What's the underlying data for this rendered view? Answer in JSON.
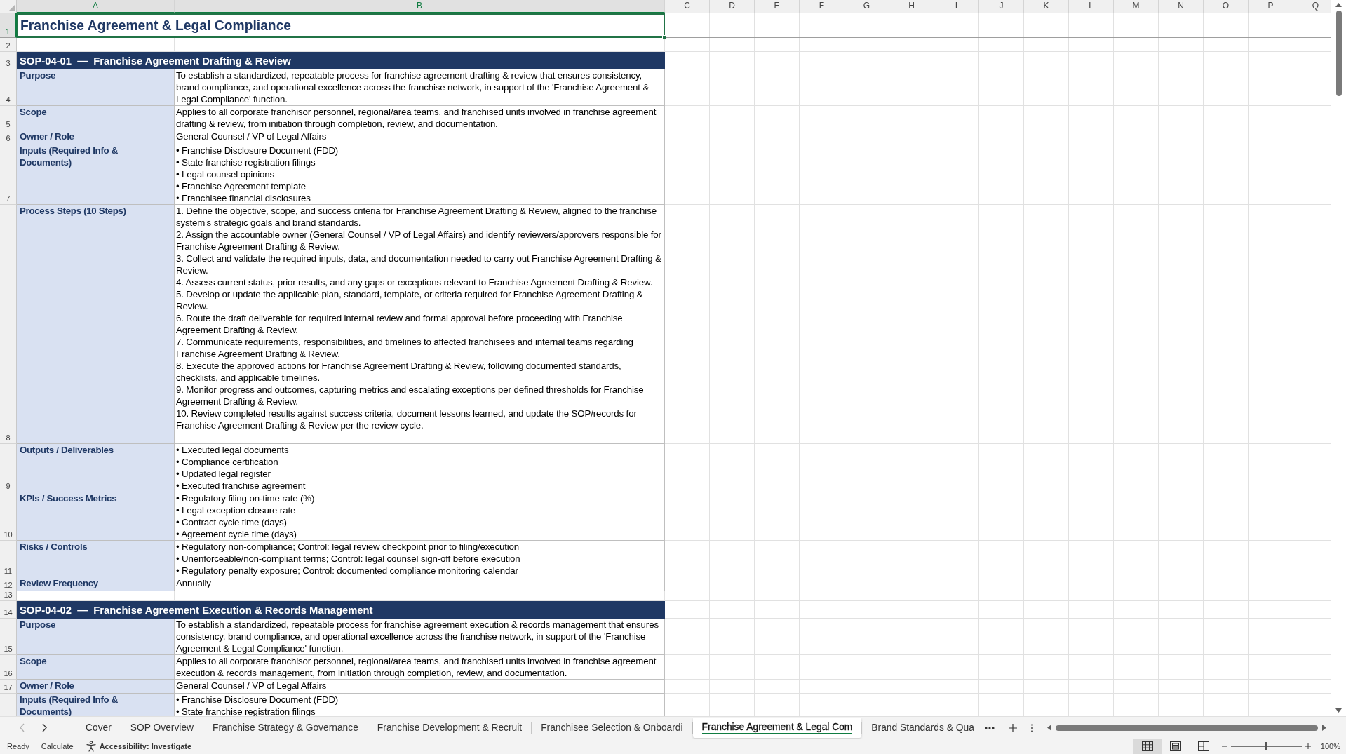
{
  "sheet": {
    "columns": [
      {
        "label": "A",
        "selected": true
      },
      {
        "label": "B",
        "selected": true
      },
      {
        "label": "C",
        "selected": false
      },
      {
        "label": "D",
        "selected": false
      },
      {
        "label": "E",
        "selected": false
      },
      {
        "label": "F",
        "selected": false
      },
      {
        "label": "G",
        "selected": false
      },
      {
        "label": "H",
        "selected": false
      },
      {
        "label": "I",
        "selected": false
      },
      {
        "label": "J",
        "selected": false
      },
      {
        "label": "K",
        "selected": false
      },
      {
        "label": "L",
        "selected": false
      },
      {
        "label": "M",
        "selected": false
      },
      {
        "label": "N",
        "selected": false
      },
      {
        "label": "O",
        "selected": false
      },
      {
        "label": "P",
        "selected": false
      },
      {
        "label": "Q",
        "selected": false
      }
    ],
    "rows": [
      {
        "number": "1",
        "selected": true,
        "kind": "title",
        "text": "Franchise Agreement & Legal Compliance"
      },
      {
        "number": "2",
        "selected": false,
        "kind": "blank"
      },
      {
        "number": "3",
        "selected": false,
        "kind": "section",
        "text": "SOP-04-01  —  Franchise Agreement Drafting & Review"
      },
      {
        "number": "4",
        "selected": false,
        "kind": "field",
        "label": "Purpose",
        "entries": [
          "To establish a standardized, repeatable process for franchise agreement drafting & review that ensures consistency, brand compliance, and operational excellence across the franchise network, in support of the 'Franchise Agreement & Legal Compliance' function."
        ]
      },
      {
        "number": "5",
        "selected": false,
        "kind": "field",
        "label": "Scope",
        "entries": [
          "Applies to all corporate franchisor personnel, regional/area teams, and franchised units involved in franchise agreement drafting & review, from initiation through completion, review, and documentation."
        ]
      },
      {
        "number": "6",
        "selected": false,
        "kind": "field",
        "label": "Owner / Role",
        "entries": [
          "General Counsel / VP of Legal Affairs"
        ]
      },
      {
        "number": "7",
        "selected": false,
        "kind": "field",
        "label": "Inputs (Required Info & Documents)",
        "entries": [
          "• Franchise Disclosure Document (FDD)",
          "• State franchise registration filings",
          "• Legal counsel opinions",
          "• Franchise Agreement template",
          "• Franchisee financial disclosures"
        ]
      },
      {
        "number": "8",
        "selected": false,
        "kind": "field",
        "label": "Process Steps (10 Steps)",
        "entries": [
          "1. Define the objective, scope, and success criteria for Franchise Agreement Drafting & Review, aligned to the franchise system's strategic goals and brand standards.",
          "2. Assign the accountable owner (General Counsel / VP of Legal Affairs) and identify reviewers/approvers responsible for Franchise Agreement Drafting & Review.",
          "3. Collect and validate the required inputs, data, and documentation needed to carry out Franchise Agreement Drafting & Review.",
          "4. Assess current status, prior results, and any gaps or exceptions relevant to Franchise Agreement Drafting & Review.",
          "5. Develop or update the applicable plan, standard, template, or criteria required for Franchise Agreement Drafting & Review.",
          "6. Route the draft deliverable for required internal review and formal approval before proceeding with Franchise Agreement Drafting & Review.",
          "7. Communicate requirements, responsibilities, and timelines to affected franchisees and internal teams regarding Franchise Agreement Drafting & Review.",
          "8. Execute the approved actions for Franchise Agreement Drafting & Review, following documented standards, checklists, and applicable timelines.",
          "9. Monitor progress and outcomes, capturing metrics and escalating exceptions per defined thresholds for Franchise Agreement Drafting & Review.",
          "10. Review completed results against success criteria, document lessons learned, and update the SOP/records for Franchise Agreement Drafting & Review per the review cycle."
        ]
      },
      {
        "number": "9",
        "selected": false,
        "kind": "field",
        "label": "Outputs / Deliverables",
        "entries": [
          "• Executed legal documents",
          "• Compliance certification",
          "• Updated legal register",
          "• Executed franchise agreement"
        ]
      },
      {
        "number": "10",
        "selected": false,
        "kind": "field",
        "label": "KPIs / Success Metrics",
        "entries": [
          "• Regulatory filing on-time rate (%)",
          "• Legal exception closure rate",
          "• Contract cycle time (days)",
          "• Agreement cycle time (days)"
        ]
      },
      {
        "number": "11",
        "selected": false,
        "kind": "field",
        "label": "Risks / Controls",
        "entries": [
          "• Regulatory non-compliance; Control: legal review checkpoint prior to filing/execution",
          "• Unenforceable/non-compliant terms; Control: legal counsel sign-off before execution",
          "• Regulatory penalty exposure; Control: documented compliance monitoring calendar"
        ]
      },
      {
        "number": "12",
        "selected": false,
        "kind": "field",
        "label": "Review Frequency",
        "entries": [
          "Annually"
        ]
      },
      {
        "number": "13",
        "selected": false,
        "kind": "blank"
      },
      {
        "number": "14",
        "selected": false,
        "kind": "section",
        "text": "SOP-04-02  —  Franchise Agreement Execution & Records Management"
      },
      {
        "number": "15",
        "selected": false,
        "kind": "field",
        "label": "Purpose",
        "entries": [
          "To establish a standardized, repeatable process for franchise agreement execution & records management that ensures consistency, brand compliance, and operational excellence across the franchise network, in support of the 'Franchise Agreement & Legal Compliance' function."
        ]
      },
      {
        "number": "16",
        "selected": false,
        "kind": "field",
        "label": "Scope",
        "entries": [
          "Applies to all corporate franchisor personnel, regional/area teams, and franchised units involved in franchise agreement execution & records management, from initiation through completion, review, and documentation."
        ]
      },
      {
        "number": "17",
        "selected": false,
        "kind": "field",
        "label": "Owner / Role",
        "entries": [
          "General Counsel / VP of Legal Affairs"
        ]
      },
      {
        "selected": false,
        "kind": "field",
        "label": "Inputs (Required Info & Documents)",
        "entries": [
          "• Franchise Disclosure Document (FDD)",
          "• State franchise registration filings"
        ]
      }
    ]
  },
  "sheet_tabs": {
    "navigation": [
      {
        "kind": "previous",
        "disabled": true
      },
      {
        "kind": "next",
        "disabled": false
      }
    ],
    "tabs": [
      {
        "label": "Cover",
        "selected": false
      },
      {
        "label": "SOP Overview",
        "selected": false
      },
      {
        "label": "Franchise Strategy & Governance",
        "selected": false
      },
      {
        "label": "Franchise Development & Recruit",
        "selected": false
      },
      {
        "label": "Franchisee Selection & Onboardi",
        "selected": false
      },
      {
        "label": "Franchise Agreement & Legal Com",
        "selected": true
      },
      {
        "label": "Brand Standards & Qua",
        "selected": false
      }
    ]
  },
  "status_bar": {
    "messages": [
      "Ready",
      "Calculate"
    ],
    "accessibility": "Accessibility: Investigate",
    "views": [
      {
        "kind": "normal",
        "selected": true
      },
      {
        "kind": "page_layout",
        "selected": false
      },
      {
        "kind": "page_break_preview",
        "selected": false
      }
    ],
    "zoom": {
      "level": 0.5,
      "reading": "100%"
    }
  }
}
